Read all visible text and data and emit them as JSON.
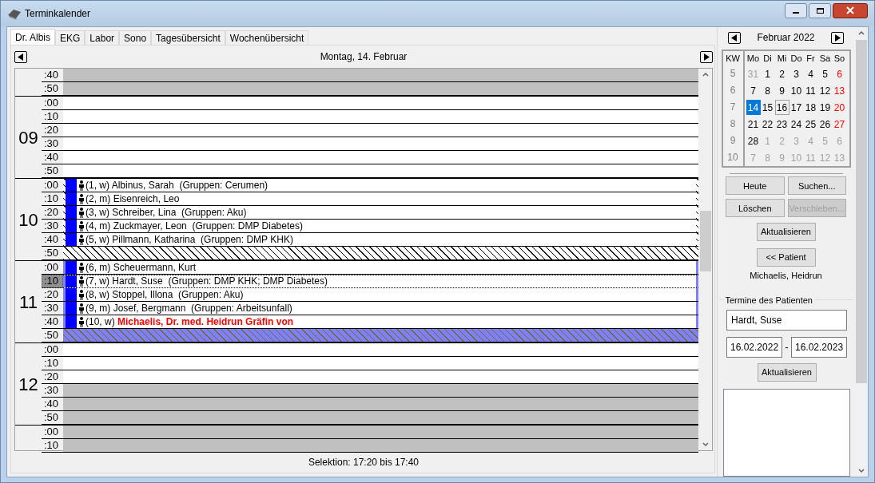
{
  "window": {
    "title": "Terminkalender"
  },
  "tabs": [
    {
      "label": "Dr. Albis",
      "selected": true
    },
    {
      "label": "EKG",
      "selected": false
    },
    {
      "label": "Labor",
      "selected": false
    },
    {
      "label": "Sono",
      "selected": false
    },
    {
      "label": "Tagesübersicht",
      "selected": false
    },
    {
      "label": "Wochenübersicht",
      "selected": false
    }
  ],
  "day_title": "Montag, 14. Februar",
  "hours": [
    {
      "slots": [
        {
          "time": ":40",
          "kind": "blocked",
          "selected": false
        },
        {
          "time": ":50",
          "kind": "blocked",
          "selected": false
        }
      ]
    },
    {
      "hour": "09",
      "slots": [
        {
          "time": ":00",
          "kind": "free",
          "selected": false
        },
        {
          "time": ":10",
          "kind": "free",
          "selected": false
        },
        {
          "time": ":20",
          "kind": "free",
          "selected": false
        },
        {
          "time": ":30",
          "kind": "free",
          "selected": false
        },
        {
          "time": ":40",
          "kind": "free",
          "selected": false
        },
        {
          "time": ":50",
          "kind": "free",
          "selected": false
        }
      ]
    },
    {
      "hour": "10",
      "marked": false,
      "slots": [
        {
          "time": ":00",
          "kind": "appointment",
          "selected": false,
          "prefix": "(1, w)",
          "name": "Albinus, Sarah",
          "groups": "(Gruppen: Cerumen)",
          "highlighted": false
        },
        {
          "time": ":10",
          "kind": "appointment",
          "selected": false,
          "prefix": "(2, m)",
          "name": "Eisenreich, Leo",
          "highlighted": false
        },
        {
          "time": ":20",
          "kind": "appointment",
          "selected": false,
          "prefix": "(3, w)",
          "name": "Schreiber, Lina",
          "groups": "(Gruppen: Aku)",
          "highlighted": false
        },
        {
          "time": ":30",
          "kind": "appointment",
          "selected": false,
          "prefix": "(4, m)",
          "name": "Zuckmayer, Leon",
          "groups": "(Gruppen: DMP Diabetes)",
          "highlighted": false
        },
        {
          "time": ":40",
          "kind": "appointment",
          "selected": false,
          "prefix": "(5, w)",
          "name": "Pillmann, Katharina",
          "groups": "(Gruppen: DMP KHK)",
          "highlighted": false
        },
        {
          "time": ":50",
          "kind": "hatched",
          "selected": false
        }
      ]
    },
    {
      "hour": "11",
      "marked": true,
      "slots": [
        {
          "time": ":00",
          "kind": "appointment",
          "selected": false,
          "prefix": "(6, m)",
          "name": "Scheuermann, Kurt",
          "highlighted": false
        },
        {
          "time": ":10",
          "kind": "appointment",
          "selected": true,
          "prefix": "(7, w)",
          "name": "Hardt, Suse",
          "groups": "(Gruppen: DMP KHK; DMP Diabetes)",
          "highlighted": false
        },
        {
          "time": ":20",
          "kind": "appointment",
          "selected": false,
          "prefix": "(8, w)",
          "name": "Stoppel, Illona",
          "groups": "(Gruppen: Aku)",
          "highlighted": false
        },
        {
          "time": ":30",
          "kind": "appointment",
          "selected": false,
          "prefix": "(9, m)",
          "name": "Josef, Bergmann",
          "groups": "(Gruppen: Arbeitsunfall)",
          "highlighted": false
        },
        {
          "time": ":40",
          "kind": "appointment",
          "selected": false,
          "prefix": "(10, w)",
          "name": "Michaelis, Dr. med. Heidrun Gräfin von",
          "highlighted": true
        },
        {
          "time": ":50",
          "kind": "hatched",
          "selected": false
        }
      ]
    },
    {
      "hour": "12",
      "slots": [
        {
          "time": ":00",
          "kind": "free",
          "selected": false
        },
        {
          "time": ":10",
          "kind": "free",
          "selected": false
        },
        {
          "time": ":20",
          "kind": "free",
          "selected": false
        },
        {
          "time": ":30",
          "kind": "blocked",
          "selected": false
        },
        {
          "time": ":40",
          "kind": "blocked",
          "selected": false
        },
        {
          "time": ":50",
          "kind": "blocked",
          "selected": false
        }
      ]
    },
    {
      "slots": [
        {
          "time": ":00",
          "kind": "blocked",
          "selected": false
        },
        {
          "time": ":10",
          "kind": "blocked",
          "selected": false
        }
      ]
    }
  ],
  "status": "Selektion: 17:20 bis 17:40",
  "calendar": {
    "month": "Februar 2022",
    "week_header": "KW",
    "weekdays": [
      "Mo",
      "Di",
      "Mi",
      "Do",
      "Fr",
      "Sa",
      "So"
    ],
    "weeks": [
      {
        "kw": "5",
        "days": [
          {
            "day": "31",
            "other_month": true,
            "selected": false,
            "today": false
          },
          {
            "day": "1",
            "other_month": false,
            "selected": false,
            "today": false
          },
          {
            "day": "2",
            "other_month": false,
            "selected": false,
            "today": false
          },
          {
            "day": "3",
            "other_month": false,
            "selected": false,
            "today": false
          },
          {
            "day": "4",
            "other_month": false,
            "selected": false,
            "today": false
          },
          {
            "day": "5",
            "other_month": false,
            "selected": false,
            "today": false
          },
          {
            "day": "6",
            "other_month": false,
            "selected": false,
            "today": false
          }
        ]
      },
      {
        "kw": "6",
        "days": [
          {
            "day": "7",
            "other_month": false,
            "selected": false,
            "today": false
          },
          {
            "day": "8",
            "other_month": false,
            "selected": false,
            "today": false
          },
          {
            "day": "9",
            "other_month": false,
            "selected": false,
            "today": false
          },
          {
            "day": "10",
            "other_month": false,
            "selected": false,
            "today": false
          },
          {
            "day": "11",
            "other_month": false,
            "selected": false,
            "today": false
          },
          {
            "day": "12",
            "other_month": false,
            "selected": false,
            "today": false
          },
          {
            "day": "13",
            "other_month": false,
            "selected": false,
            "today": false
          }
        ]
      },
      {
        "kw": "7",
        "days": [
          {
            "day": "14",
            "other_month": false,
            "selected": true,
            "today": false
          },
          {
            "day": "15",
            "other_month": false,
            "selected": false,
            "today": false
          },
          {
            "day": "16",
            "other_month": false,
            "selected": false,
            "today": true
          },
          {
            "day": "17",
            "other_month": false,
            "selected": false,
            "today": false
          },
          {
            "day": "18",
            "other_month": false,
            "selected": false,
            "today": false
          },
          {
            "day": "19",
            "other_month": false,
            "selected": false,
            "today": false
          },
          {
            "day": "20",
            "other_month": false,
            "selected": false,
            "today": false
          }
        ]
      },
      {
        "kw": "8",
        "days": [
          {
            "day": "21",
            "other_month": false,
            "selected": false,
            "today": false
          },
          {
            "day": "22",
            "other_month": false,
            "selected": false,
            "today": false
          },
          {
            "day": "23",
            "other_month": false,
            "selected": false,
            "today": false
          },
          {
            "day": "24",
            "other_month": false,
            "selected": false,
            "today": false
          },
          {
            "day": "25",
            "other_month": false,
            "selected": false,
            "today": false
          },
          {
            "day": "26",
            "other_month": false,
            "selected": false,
            "today": false
          },
          {
            "day": "27",
            "other_month": false,
            "selected": false,
            "today": false
          }
        ]
      },
      {
        "kw": "9",
        "days": [
          {
            "day": "28",
            "other_month": false,
            "selected": false,
            "today": false
          },
          {
            "day": "1",
            "other_month": true,
            "selected": false,
            "today": false
          },
          {
            "day": "2",
            "other_month": true,
            "selected": false,
            "today": false
          },
          {
            "day": "3",
            "other_month": true,
            "selected": false,
            "today": false
          },
          {
            "day": "4",
            "other_month": true,
            "selected": false,
            "today": false
          },
          {
            "day": "5",
            "other_month": true,
            "selected": false,
            "today": false
          },
          {
            "day": "6",
            "other_month": true,
            "selected": false,
            "today": false
          }
        ]
      },
      {
        "kw": "10",
        "days": [
          {
            "day": "7",
            "other_month": true,
            "selected": false,
            "today": false
          },
          {
            "day": "8",
            "other_month": true,
            "selected": false,
            "today": false
          },
          {
            "day": "9",
            "other_month": true,
            "selected": false,
            "today": false
          },
          {
            "day": "10",
            "other_month": true,
            "selected": false,
            "today": false
          },
          {
            "day": "11",
            "other_month": true,
            "selected": false,
            "today": false
          },
          {
            "day": "12",
            "other_month": true,
            "selected": false,
            "today": false
          },
          {
            "day": "13",
            "other_month": true,
            "selected": false,
            "today": false
          }
        ]
      }
    ]
  },
  "buttons": [
    {
      "label": "Heute",
      "disabled": false
    },
    {
      "label": "Suchen...",
      "disabled": false
    },
    {
      "label": "Löschen",
      "disabled": false
    },
    {
      "label": "Verschieben...",
      "disabled": true
    }
  ],
  "refresh_button": "Aktualisieren",
  "patient_button": "<< Patient",
  "patient_name": "Michaelis, Heidrun",
  "patient_appointments": {
    "title": "Termine des Patienten",
    "patient": "Hardt, Suse",
    "date_from": "16.02.2022",
    "date_to": "16.02.2023",
    "separator": "-",
    "refresh_button": "Aktualisieren"
  }
}
